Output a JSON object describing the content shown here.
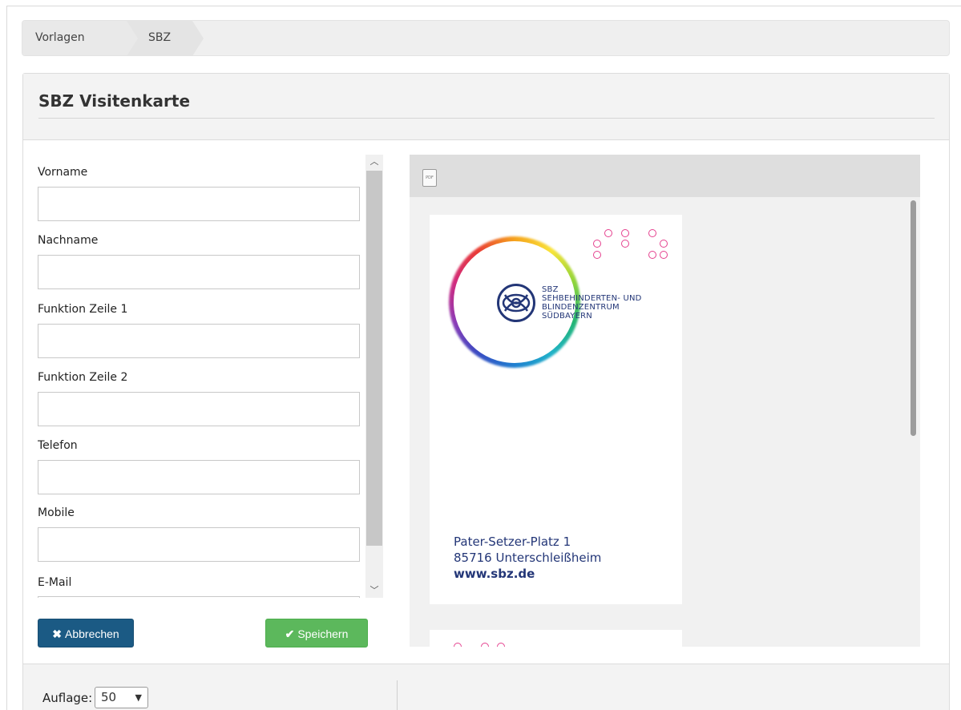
{
  "breadcrumb": {
    "items": [
      "Vorlagen",
      "SBZ"
    ]
  },
  "panel": {
    "title": "SBZ Visitenkarte"
  },
  "form": {
    "fields": [
      {
        "label": "Vorname",
        "value": ""
      },
      {
        "label": "Nachname",
        "value": ""
      },
      {
        "label": "Funktion Zeile 1",
        "value": ""
      },
      {
        "label": "Funktion Zeile 2",
        "value": ""
      },
      {
        "label": "Telefon",
        "value": ""
      },
      {
        "label": "Mobile",
        "value": ""
      },
      {
        "label": "E-Mail",
        "value": ""
      }
    ]
  },
  "buttons": {
    "cancel_label": "Abbrechen",
    "save_label": "Speichern",
    "cancel_color": "#1b5a84",
    "save_color": "#5cb85c"
  },
  "preview": {
    "toolbar_icon": "pdf-icon",
    "card": {
      "logo_lines": [
        "SBZ",
        "SEHBEHINDERTEN- UND",
        "BLINDENZENTRUM",
        "SÜDBAYERN"
      ],
      "address_line1": "Pater-Setzer-Platz 1",
      "address_line2": "85716 Unterschleißheim",
      "website": "www.sbz.de",
      "brand_color": "#233677"
    }
  },
  "footer": {
    "auflage_label": "Auflage:",
    "auflage_value": "50"
  },
  "icons": {
    "cancel": "times-icon",
    "save": "check-icon",
    "scroll_up": "chevron-up-icon",
    "scroll_down": "chevron-down-icon"
  }
}
